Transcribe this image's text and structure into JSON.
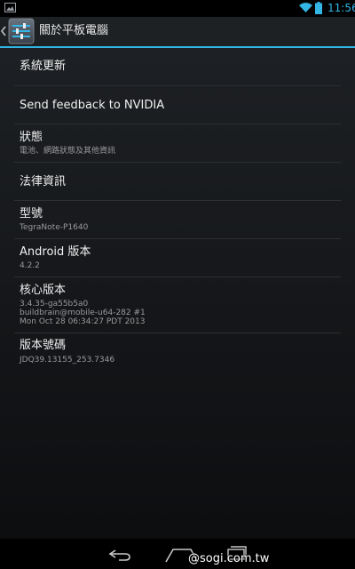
{
  "status_bar": {
    "time": "11:56",
    "icons": [
      "picture-icon",
      "wifi-icon",
      "battery-icon"
    ],
    "accent_color": "#33b5e5"
  },
  "action_bar": {
    "title": "關於平板電腦",
    "icons": [
      "up-chevron-icon",
      "settings-sliders-icon"
    ],
    "underline_color": "#33b5e5"
  },
  "items": [
    {
      "title": "系統更新"
    },
    {
      "title": "Send feedback to NVIDIA"
    },
    {
      "title": "狀態",
      "summary": "電池、網路狀態及其他資訊"
    },
    {
      "title": "法律資訊"
    },
    {
      "title": "型號",
      "summary": "TegraNote-P1640"
    },
    {
      "title": "Android 版本",
      "summary": "4.2.2"
    },
    {
      "title": "核心版本",
      "summary_lines": [
        "3.4.35-ga55b5a0",
        "buildbrain@mobile-u64-282 #1",
        "Mon Oct 28 06:34:27 PDT 2013"
      ]
    },
    {
      "title": "版本號碼",
      "summary": "JDQ39.13155_253.7346"
    }
  ],
  "nav_bar": {
    "icons": [
      "back-icon",
      "home-icon",
      "recent-apps-icon"
    ],
    "watermark": "@sogi.com.tw"
  }
}
